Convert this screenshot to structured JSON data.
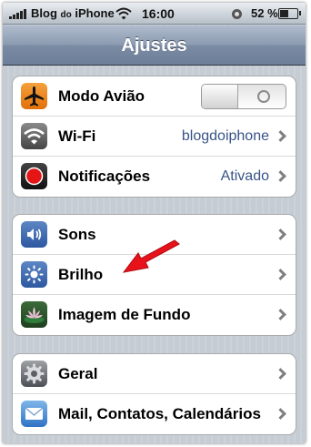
{
  "status_bar": {
    "carrier": "Blog",
    "carrier_suffix": "do",
    "carrier_name": "iPhone",
    "time": "16:00",
    "battery_percent": "52 %",
    "battery_level": 0.52
  },
  "nav": {
    "title": "Ajustes"
  },
  "groups": [
    {
      "rows": [
        {
          "label": "Modo Avião",
          "icon": "airplane-icon",
          "control": "toggle",
          "toggle_value": "O"
        },
        {
          "label": "Wi-Fi",
          "icon": "wifi-icon",
          "value": "blogdoiphone"
        },
        {
          "label": "Notificações",
          "icon": "notifications-icon",
          "value": "Ativado"
        }
      ]
    },
    {
      "rows": [
        {
          "label": "Sons",
          "icon": "sounds-icon"
        },
        {
          "label": "Brilho",
          "icon": "brightness-icon"
        },
        {
          "label": "Imagem de Fundo",
          "icon": "wallpaper-icon"
        }
      ]
    },
    {
      "rows": [
        {
          "label": "Geral",
          "icon": "gear-icon"
        },
        {
          "label": "Mail, Contatos, Calendários",
          "icon": "mail-icon"
        }
      ]
    }
  ],
  "colors": {
    "background": "#c5ccd4",
    "nav_bar": "#7b8ba4",
    "value_text": "#385487",
    "annotation_arrow": "#e8121b"
  }
}
